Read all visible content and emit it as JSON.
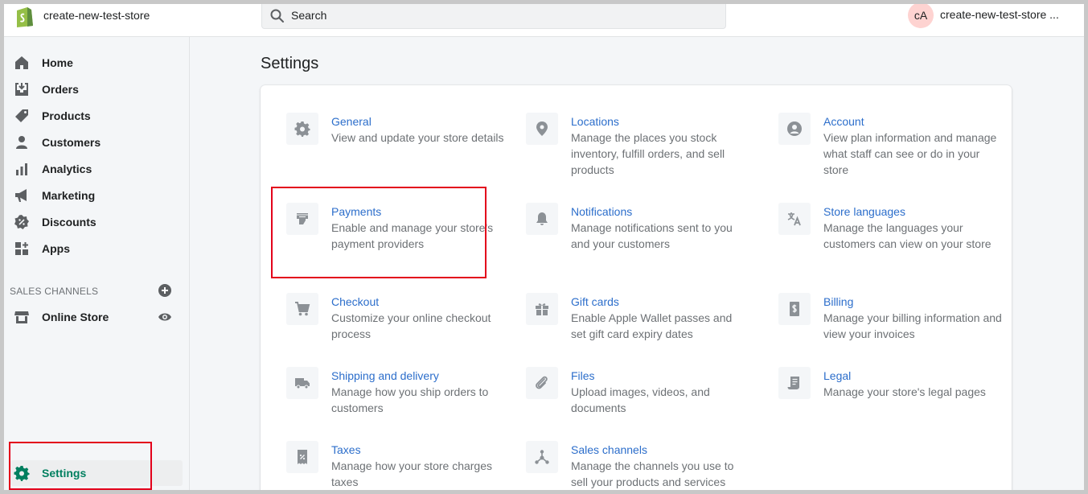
{
  "header": {
    "store_name": "create-new-test-store",
    "search_placeholder": "Search",
    "avatar_initials": "cA",
    "account_name": "create-new-test-store ..."
  },
  "sidebar": {
    "items": [
      {
        "label": "Home",
        "icon": "home-icon"
      },
      {
        "label": "Orders",
        "icon": "orders-icon"
      },
      {
        "label": "Products",
        "icon": "tag-icon"
      },
      {
        "label": "Customers",
        "icon": "person-icon"
      },
      {
        "label": "Analytics",
        "icon": "bar-chart-icon"
      },
      {
        "label": "Marketing",
        "icon": "megaphone-icon"
      },
      {
        "label": "Discounts",
        "icon": "discount-icon"
      },
      {
        "label": "Apps",
        "icon": "apps-icon"
      }
    ],
    "sales_channels_title": "SALES CHANNELS",
    "online_store": "Online Store",
    "settings": "Settings"
  },
  "main": {
    "title": "Settings",
    "tiles": [
      {
        "title": "General",
        "desc": "View and update your store details",
        "icon": "gear-icon"
      },
      {
        "title": "Locations",
        "desc": "Manage the places you stock inventory, fulfill orders, and sell products",
        "icon": "location-pin-icon"
      },
      {
        "title": "Account",
        "desc": "View plan information and manage what staff can see or do in your store",
        "icon": "account-icon"
      },
      {
        "title": "Payments",
        "desc": "Enable and manage your store's payment providers",
        "icon": "payments-icon"
      },
      {
        "title": "Notifications",
        "desc": "Manage notifications sent to you and your customers",
        "icon": "bell-icon"
      },
      {
        "title": "Store languages",
        "desc": "Manage the languages your customers can view on your store",
        "icon": "translate-icon"
      },
      {
        "title": "Checkout",
        "desc": "Customize your online checkout process",
        "icon": "cart-icon"
      },
      {
        "title": "Gift cards",
        "desc": "Enable Apple Wallet passes and set gift card expiry dates",
        "icon": "gift-icon"
      },
      {
        "title": "Billing",
        "desc": "Manage your billing information and view your invoices",
        "icon": "billing-icon"
      },
      {
        "title": "Shipping and delivery",
        "desc": "Manage how you ship orders to customers",
        "icon": "truck-icon"
      },
      {
        "title": "Files",
        "desc": "Upload images, videos, and documents",
        "icon": "paperclip-icon"
      },
      {
        "title": "Legal",
        "desc": "Manage your store's legal pages",
        "icon": "legal-icon"
      },
      {
        "title": "Taxes",
        "desc": "Manage how your store charges taxes",
        "icon": "tax-icon"
      },
      {
        "title": "Sales channels",
        "desc": "Manage the channels you use to sell your products and services",
        "icon": "channels-icon"
      }
    ]
  },
  "colors": {
    "link": "#2c6ecb",
    "active_green": "#007f5f",
    "highlight_red": "#e3001b",
    "avatar_bg": "#fed3d1"
  }
}
